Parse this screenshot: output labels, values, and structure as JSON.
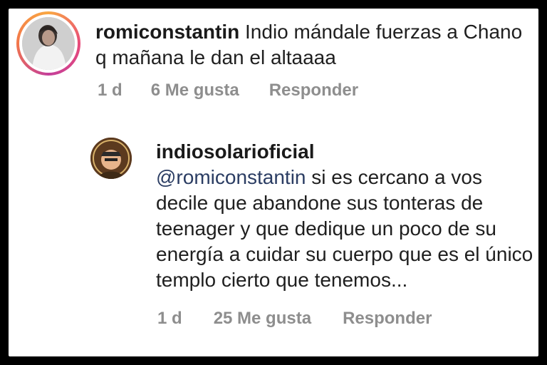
{
  "comment1": {
    "username": "romiconstantin",
    "text": "Indio mándale fuerzas a Chano q mañana le dan el altaaaa",
    "time": "1 d",
    "likes": "6 Me gusta",
    "reply_label": "Responder"
  },
  "comment2": {
    "username": "indiosolarioficial",
    "mention": "@romiconstantin",
    "text": "si es cercano a vos decile que abandone sus tonteras de teenager y que dedique un poco de su energía a cuidar su cuerpo que es el único templo cierto que tenemos...",
    "time": "1 d",
    "likes": "25 Me gusta",
    "reply_label": "Responder"
  },
  "colors": {
    "background": "#000000",
    "card": "#ffffff",
    "text": "#1f1f1f",
    "meta": "#8e8e8e",
    "mention": "#2b3d63",
    "story_ring": "#e84a79"
  }
}
